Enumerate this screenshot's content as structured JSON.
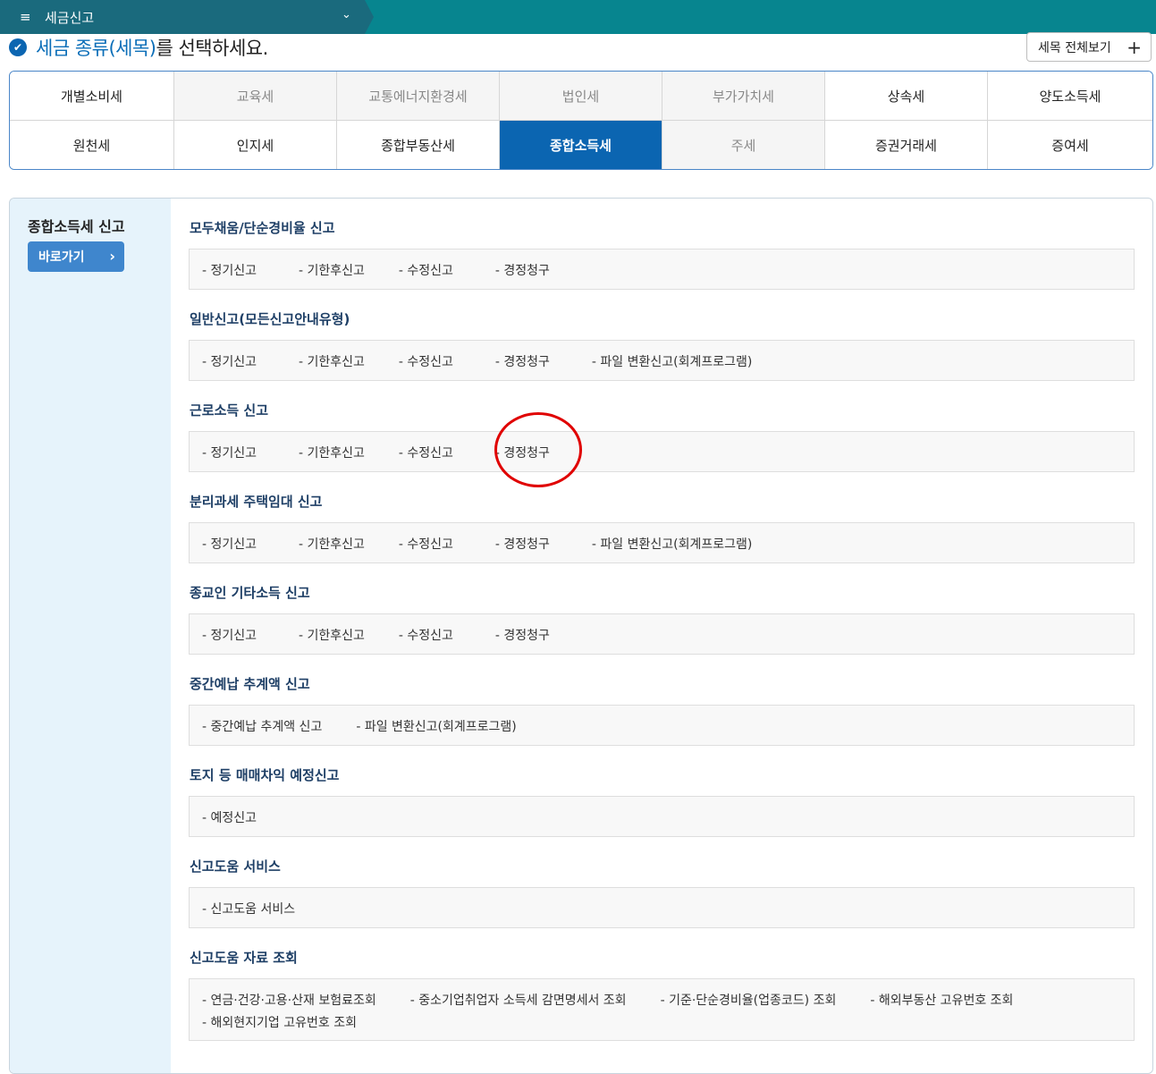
{
  "topbar": {
    "menu_icon": "≡",
    "menu_title": "세금신고",
    "chevron": "⌄"
  },
  "header": {
    "check_icon": "✔",
    "title_highlight": "세금 종류(세목)",
    "title_rest": "를 선택하세요.",
    "view_all_label": "세목 전체보기",
    "plus": "+"
  },
  "tax_types": [
    {
      "label": "개별소비세",
      "state": "normal"
    },
    {
      "label": "교육세",
      "state": "dim"
    },
    {
      "label": "교통에너지환경세",
      "state": "dim"
    },
    {
      "label": "법인세",
      "state": "dim"
    },
    {
      "label": "부가가치세",
      "state": "dim"
    },
    {
      "label": "상속세",
      "state": "normal"
    },
    {
      "label": "양도소득세",
      "state": "normal"
    },
    {
      "label": "원천세",
      "state": "normal"
    },
    {
      "label": "인지세",
      "state": "normal"
    },
    {
      "label": "종합부동산세",
      "state": "normal"
    },
    {
      "label": "종합소득세",
      "state": "active"
    },
    {
      "label": "주세",
      "state": "dim"
    },
    {
      "label": "증권거래세",
      "state": "normal"
    },
    {
      "label": "증여세",
      "state": "normal"
    }
  ],
  "sidebar": {
    "title": "종합소득세 신고",
    "goto_label": "바로가기",
    "goto_chevron": "›"
  },
  "sections": [
    {
      "title": "모두채움/단순경비율 신고",
      "items": [
        [
          "- 정기신고",
          "- 기한후신고",
          "- 수정신고",
          "- 경정청구"
        ]
      ]
    },
    {
      "title": "일반신고(모든신고안내유형)",
      "items": [
        [
          "- 정기신고",
          "- 기한후신고",
          "- 수정신고",
          "- 경정청구",
          "- 파일 변환신고(회계프로그램)"
        ]
      ]
    },
    {
      "title": "근로소득 신고",
      "items": [
        [
          "- 정기신고",
          "- 기한후신고",
          "- 수정신고",
          "- 경정청구"
        ]
      ]
    },
    {
      "title": "분리과세 주택임대 신고",
      "items": [
        [
          "- 정기신고",
          "- 기한후신고",
          "- 수정신고",
          "- 경정청구",
          "- 파일 변환신고(회계프로그램)"
        ]
      ]
    },
    {
      "title": "종교인 기타소득 신고",
      "items": [
        [
          "- 정기신고",
          "- 기한후신고",
          "- 수정신고",
          "- 경정청구"
        ]
      ]
    },
    {
      "title": "중간예납 추계액 신고",
      "items": [
        [
          "- 중간예납 추계액 신고",
          "- 파일 변환신고(회계프로그램)"
        ]
      ]
    },
    {
      "title": "토지 등 매매차익 예정신고",
      "items": [
        [
          "- 예정신고"
        ]
      ]
    },
    {
      "title": "신고도움 서비스",
      "items": [
        [
          "- 신고도움 서비스"
        ]
      ]
    },
    {
      "title": "신고도움 자료 조회",
      "items": [
        [
          "- 연금·건강·고용·산재 보험료조회",
          "- 중소기업취업자 소득세 감면명세서 조회",
          "- 기준·단순경비율(업종코드) 조회",
          "- 해외부동산 고유번호 조회"
        ],
        [
          "- 해외현지기업 고유번호 조회"
        ]
      ]
    }
  ]
}
